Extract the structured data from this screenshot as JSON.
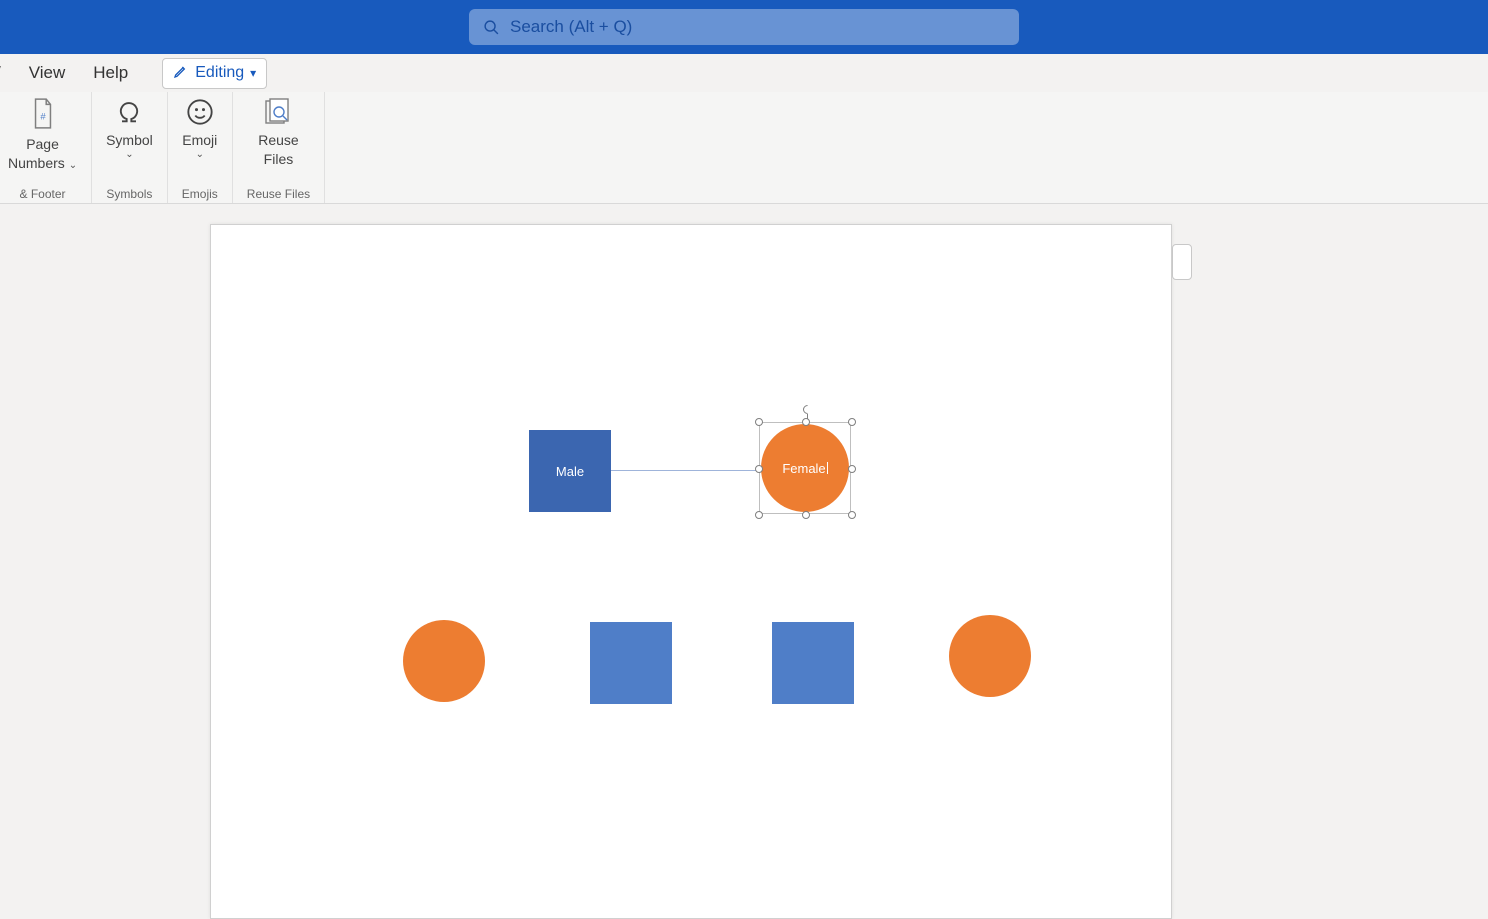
{
  "titlebar": {
    "search_placeholder": "Search (Alt + Q)"
  },
  "menubar": {
    "tab_partial": "/",
    "tab_view": "View",
    "tab_help": "Help",
    "editing_label": "Editing"
  },
  "ribbon": {
    "page_numbers": {
      "label_line1": "Page",
      "label_line2": "Numbers",
      "group_label": "& Footer"
    },
    "symbol": {
      "label": "Symbol",
      "group_label": "Symbols"
    },
    "emoji": {
      "label": "Emoji",
      "group_label": "Emojis"
    },
    "reuse_files": {
      "label_line1": "Reuse",
      "label_line2": "Files",
      "group_label": "Reuse Files"
    }
  },
  "shapes": {
    "male_label": "Male",
    "female_label": "Female"
  },
  "colors": {
    "brand_blue": "#185abd",
    "shape_blue_dark": "#3b66b0",
    "shape_blue": "#4f7ec8",
    "shape_orange": "#ed7d31"
  }
}
